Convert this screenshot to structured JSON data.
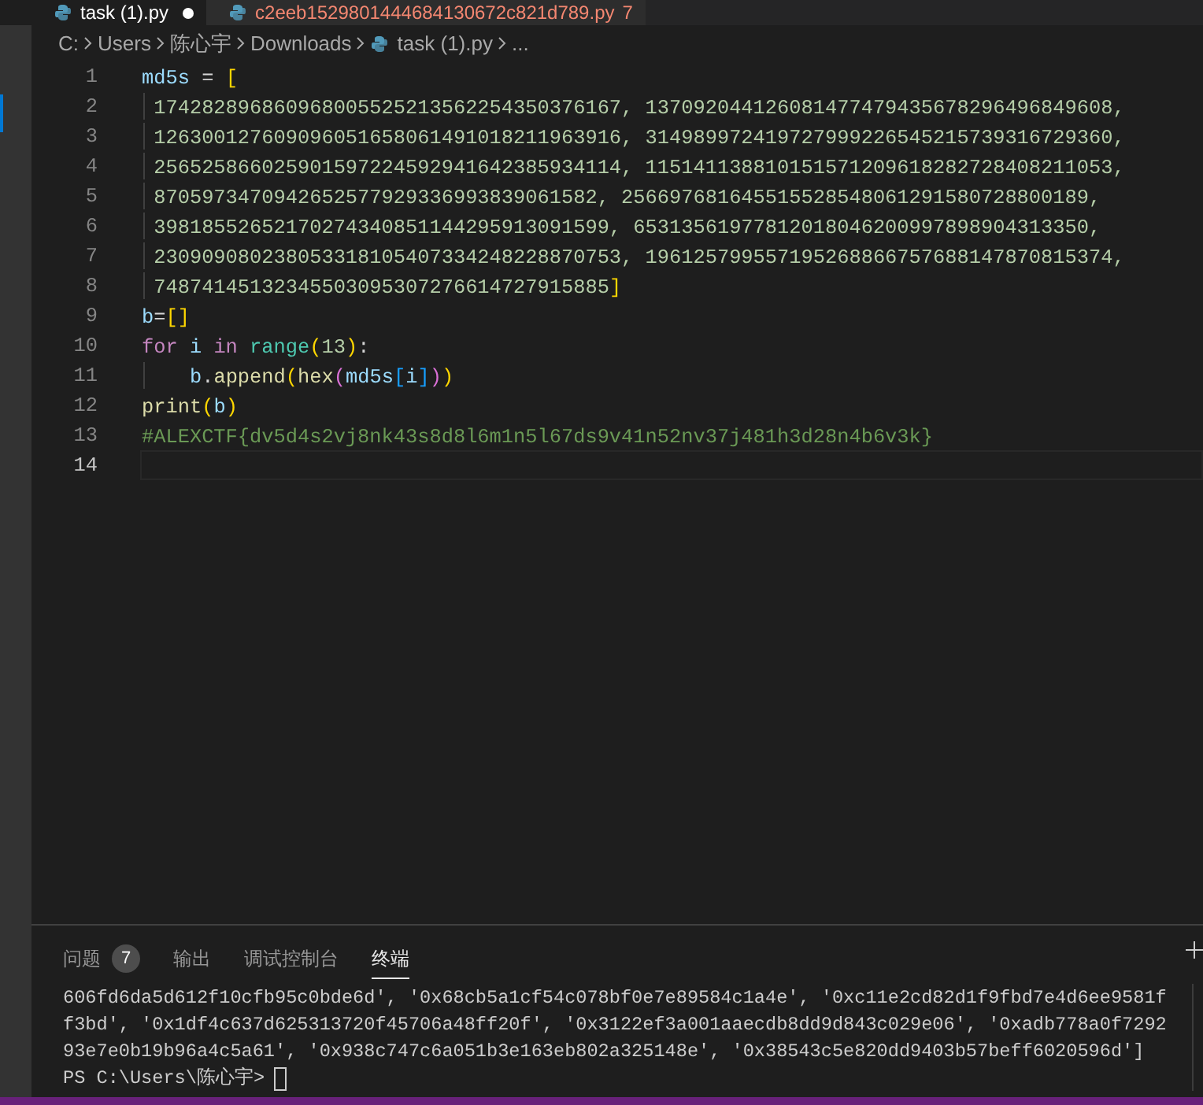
{
  "tabs": [
    {
      "label": "task (1).py",
      "selected": true,
      "modified": true,
      "error": false
    },
    {
      "label": "c2eeb1529801444684130672c821d789.py",
      "selected": false,
      "modified": false,
      "error": true,
      "problems": "7"
    }
  ],
  "breadcrumb": [
    {
      "label": "C:",
      "file": false
    },
    {
      "label": "Users",
      "file": false
    },
    {
      "label": "陈心宇",
      "file": false
    },
    {
      "label": "Downloads",
      "file": false
    },
    {
      "label": "task (1).py",
      "file": true
    },
    {
      "label": "...",
      "file": false
    }
  ],
  "code_lines": [
    {
      "number": "1",
      "current": false,
      "guide": false,
      "tokens": [
        {
          "text": "md5s",
          "kind": "name"
        },
        {
          "text": " = ",
          "kind": "text"
        },
        {
          "text": "[",
          "kind": "brace1"
        }
      ]
    },
    {
      "number": "2",
      "current": false,
      "guide": true,
      "tokens": [
        {
          "text": " 174282896860968005525213562254350376167, 137092044126081477479435678296496849608,",
          "kind": "number"
        }
      ]
    },
    {
      "number": "3",
      "current": false,
      "guide": true,
      "tokens": [
        {
          "text": " 126300127609096051658061491018211963916, 314989972419727999226545215739316729360,",
          "kind": "number"
        }
      ]
    },
    {
      "number": "4",
      "current": false,
      "guide": true,
      "tokens": [
        {
          "text": " 256525866025901597224592941642385934114, 115141138810151571209618282728408211053,",
          "kind": "number"
        }
      ]
    },
    {
      "number": "5",
      "current": false,
      "guide": true,
      "tokens": [
        {
          "text": " 8705973470942652577929336993839061582, 256697681645515528548061291580728800189,",
          "kind": "number"
        }
      ]
    },
    {
      "number": "6",
      "current": false,
      "guide": true,
      "tokens": [
        {
          "text": " 39818552652170274340851144295913091599, 65313561977812018046200997898904313350,",
          "kind": "number"
        }
      ]
    },
    {
      "number": "7",
      "current": false,
      "guide": true,
      "tokens": [
        {
          "text": " 230909080238053318105407334248228870753, 196125799557195268866757688147870815374,",
          "kind": "number"
        }
      ]
    },
    {
      "number": "8",
      "current": false,
      "guide": true,
      "tokens": [
        {
          "text": " 74874145132345503095307276614727915885",
          "kind": "number"
        },
        {
          "text": "]",
          "kind": "brace1"
        }
      ]
    },
    {
      "number": "9",
      "current": false,
      "guide": false,
      "tokens": [
        {
          "text": "b",
          "kind": "name"
        },
        {
          "text": "=",
          "kind": "text"
        },
        {
          "text": "[]",
          "kind": "brace1"
        }
      ]
    },
    {
      "number": "10",
      "current": false,
      "guide": false,
      "tokens": [
        {
          "text": "for",
          "kind": "keyword"
        },
        {
          "text": " i ",
          "kind": "name"
        },
        {
          "text": "in ",
          "kind": "keyword"
        },
        {
          "text": "range",
          "kind": "builtin"
        },
        {
          "text": "(",
          "kind": "brace1"
        },
        {
          "text": "13",
          "kind": "number"
        },
        {
          "text": ")",
          "kind": "brace1"
        },
        {
          "text": ":",
          "kind": "text"
        }
      ]
    },
    {
      "number": "11",
      "current": false,
      "guide": true,
      "tokens": [
        {
          "text": "    b",
          "kind": "name"
        },
        {
          "text": ".",
          "kind": "text"
        },
        {
          "text": "append",
          "kind": "call"
        },
        {
          "text": "(",
          "kind": "brace1"
        },
        {
          "text": "hex",
          "kind": "call"
        },
        {
          "text": "(",
          "kind": "brace2"
        },
        {
          "text": "md5s",
          "kind": "name"
        },
        {
          "text": "[",
          "kind": "brace3"
        },
        {
          "text": "i",
          "kind": "name"
        },
        {
          "text": "]",
          "kind": "brace3"
        },
        {
          "text": ")",
          "kind": "brace2"
        },
        {
          "text": ")",
          "kind": "brace1"
        }
      ]
    },
    {
      "number": "12",
      "current": false,
      "guide": false,
      "tokens": [
        {
          "text": "print",
          "kind": "call"
        },
        {
          "text": "(",
          "kind": "brace1"
        },
        {
          "text": "b",
          "kind": "name"
        },
        {
          "text": ")",
          "kind": "brace1"
        }
      ]
    },
    {
      "number": "13",
      "current": false,
      "guide": false,
      "tokens": [
        {
          "text": "#ALEXCTF{dv5d4s2vj8nk43s8d8l6m1n5l67ds9v41n52nv37j481h3d28n4b6v3k}",
          "kind": "comment"
        }
      ]
    },
    {
      "number": "14",
      "current": true,
      "guide": false
    }
  ],
  "panel_tabs": [
    {
      "label": "问题",
      "selected": false,
      "badge": "7"
    },
    {
      "label": "输出",
      "selected": false
    },
    {
      "label": "调试控制台",
      "selected": false
    },
    {
      "label": "终端",
      "selected": true
    }
  ],
  "terminal": {
    "lines": [
      "606fd6da5d612f10cfb95c0bde6d', '0x68cb5a1cf54c078bf0e7e89584c1a4e', '0xc11e2cd82d1f9fbd7e4d6ee9581f",
      "f3bd', '0x1df4c637d625313720f45706a48ff20f', '0x3122ef3a001aaecdb8dd9d843c029e06', '0xadb778a0f7292",
      "93e7e0b19b96a4c5a61', '0x938c747c6a051b3e163eb802a325148e', '0x38543c5e820dd9403b57beff6020596d']"
    ],
    "prompt": "PS C:\\Users\\陈心宇>"
  }
}
